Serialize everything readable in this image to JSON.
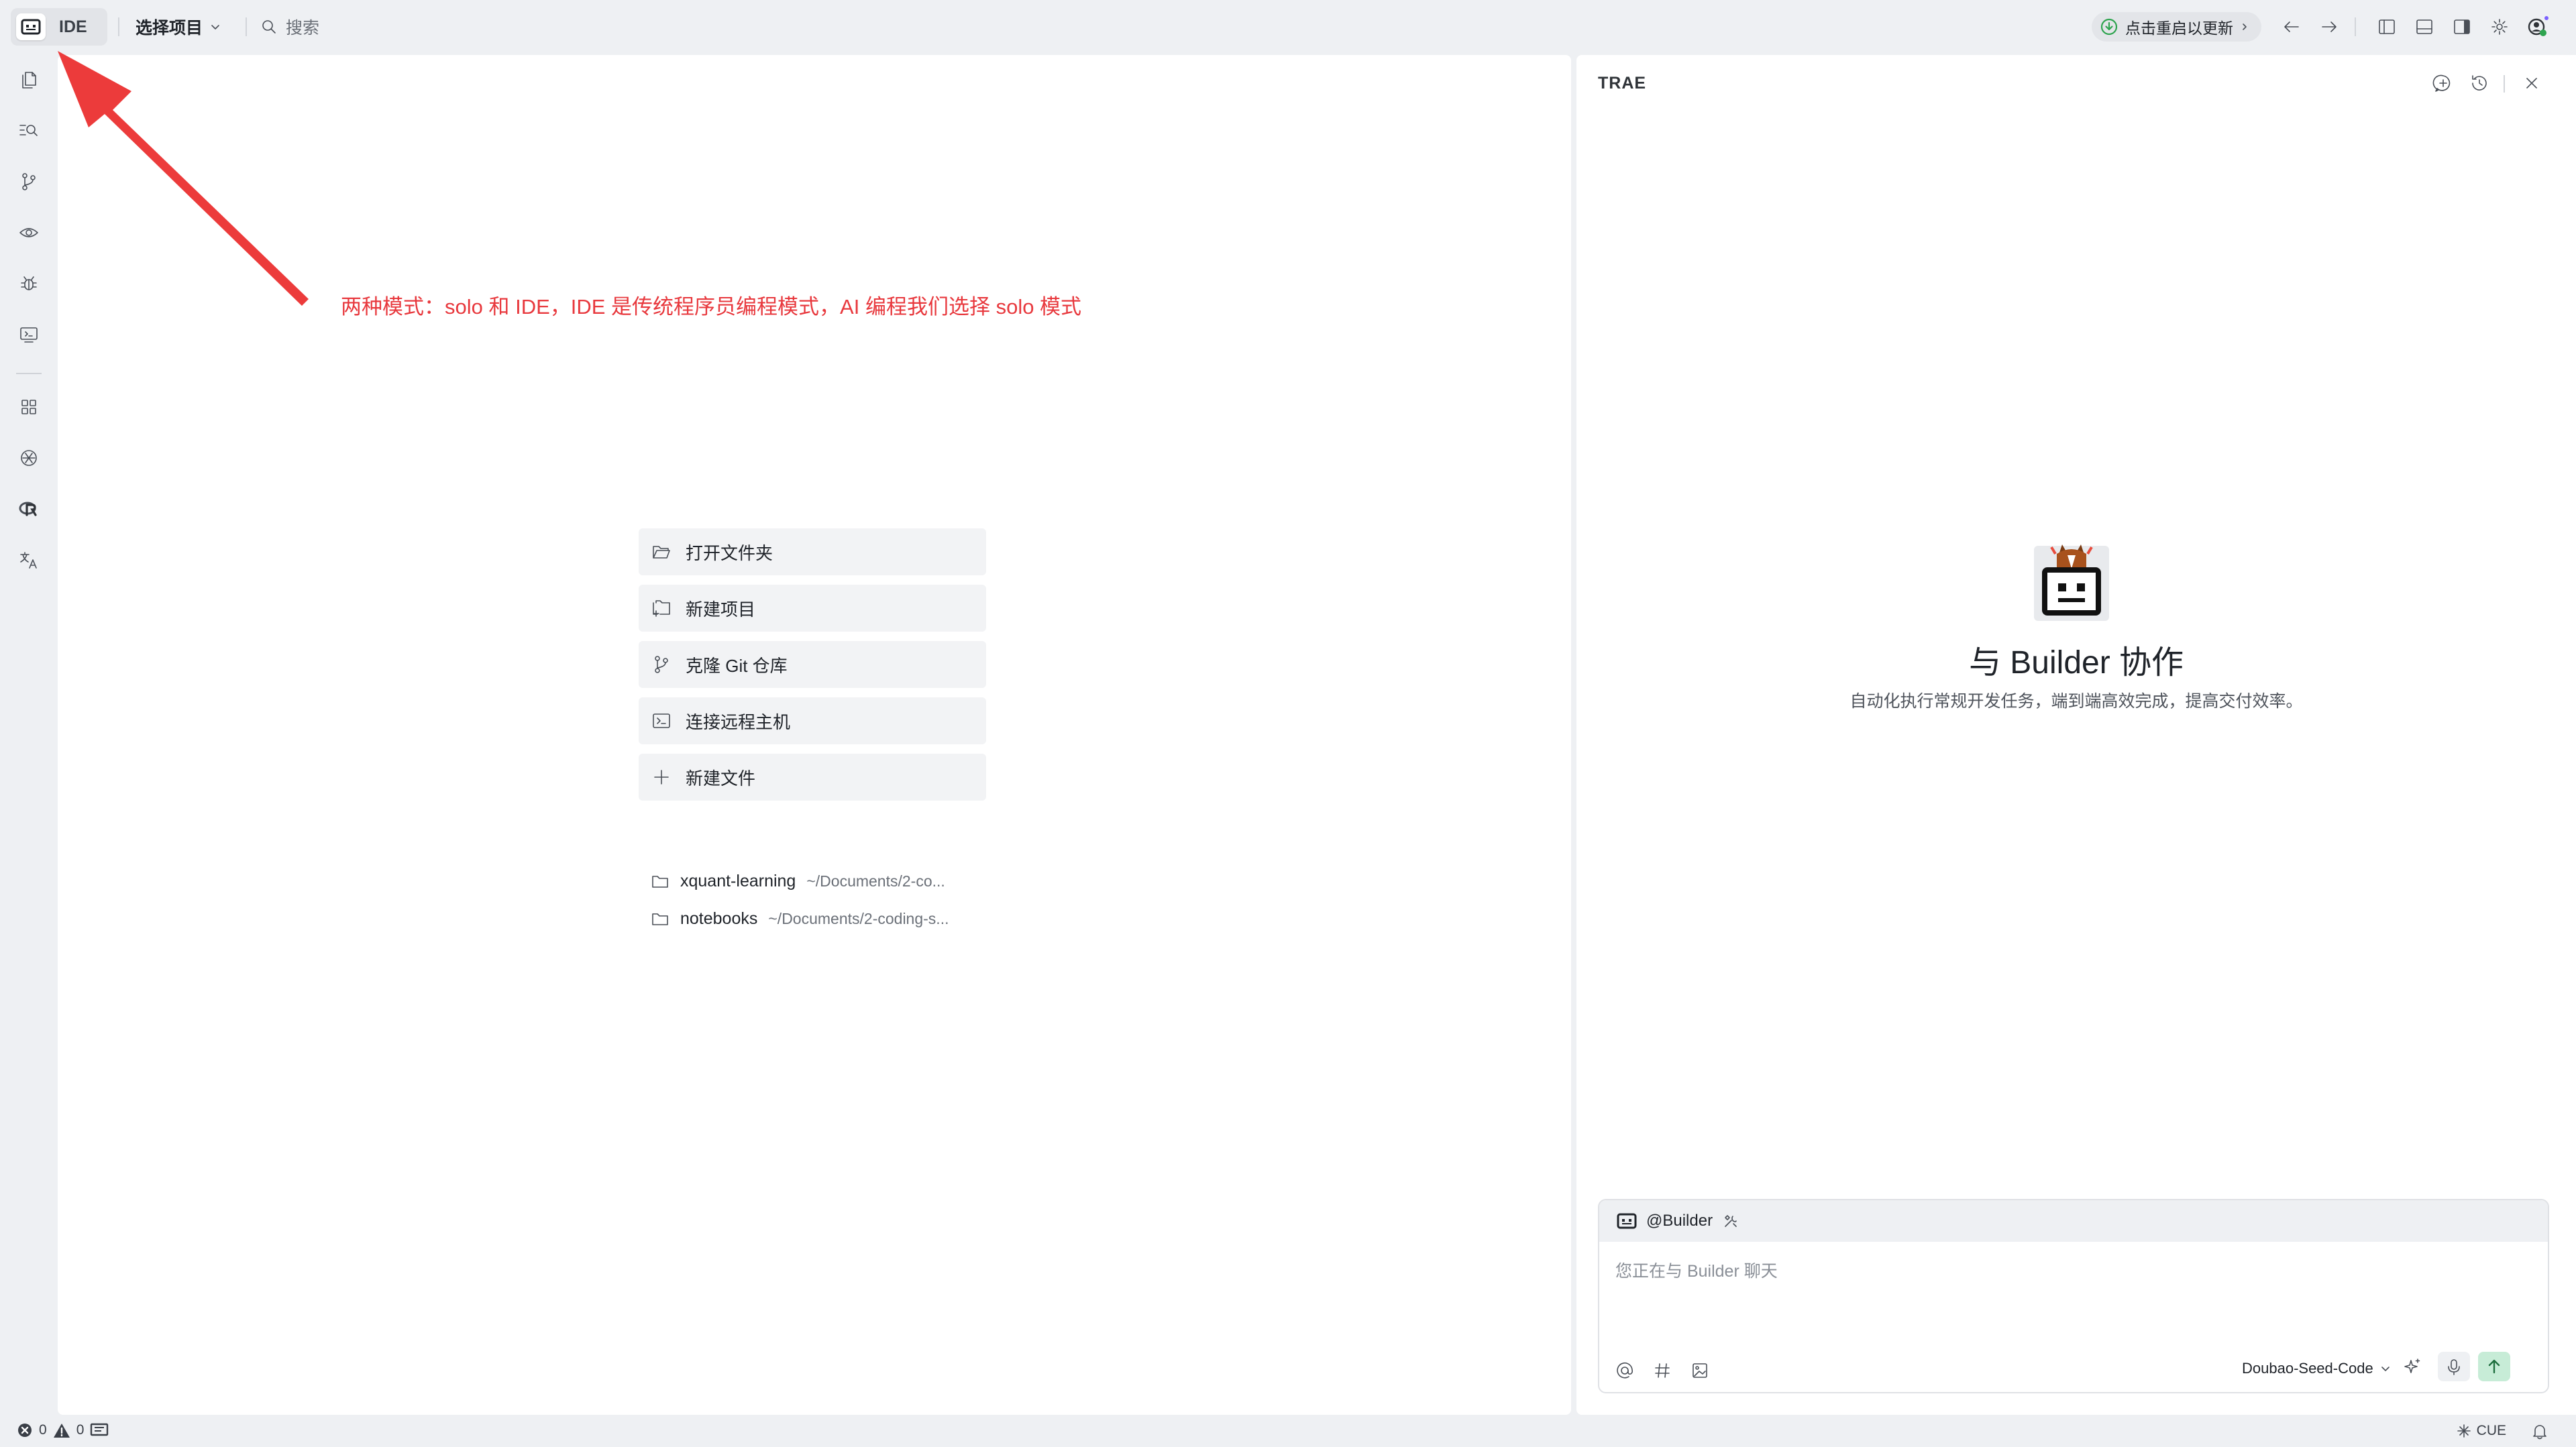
{
  "topbar": {
    "mode_label": "IDE",
    "project_select": "选择项目",
    "search_placeholder": "搜索",
    "update_label": "点击重启以更新"
  },
  "editor": {
    "start_actions": [
      {
        "label": "打开文件夹",
        "icon": "folder-open-icon"
      },
      {
        "label": "新建项目",
        "icon": "new-project-icon"
      },
      {
        "label": "克隆 Git 仓库",
        "icon": "git-branch-icon"
      },
      {
        "label": "连接远程主机",
        "icon": "remote-terminal-icon"
      },
      {
        "label": "新建文件",
        "icon": "plus-icon"
      }
    ],
    "recent": [
      {
        "name": "xquant-learning",
        "path": "~/Documents/2-co..."
      },
      {
        "name": "notebooks",
        "path": "~/Documents/2-coding-s..."
      }
    ]
  },
  "annotation": {
    "text": "两种模式：solo 和 IDE，IDE 是传统程序员编程模式，AI 编程我们选择 solo 模式",
    "color": "#e8383d"
  },
  "chat": {
    "title": "TRAE",
    "heading": "与 Builder 协作",
    "subheading": "自动化执行常规开发任务，端到端高效完成，提高交付效率。",
    "agent_label": "@Builder",
    "input_placeholder": "您正在与 Builder 聊天",
    "model_label": "Doubao-Seed-Code"
  },
  "statusbar": {
    "errors": "0",
    "warnings": "0",
    "cue_label": "CUE"
  },
  "colors": {
    "accent_green": "#2ea44f",
    "annotation_red": "#e8383d",
    "send_button_bg": "#c7ecd7"
  }
}
